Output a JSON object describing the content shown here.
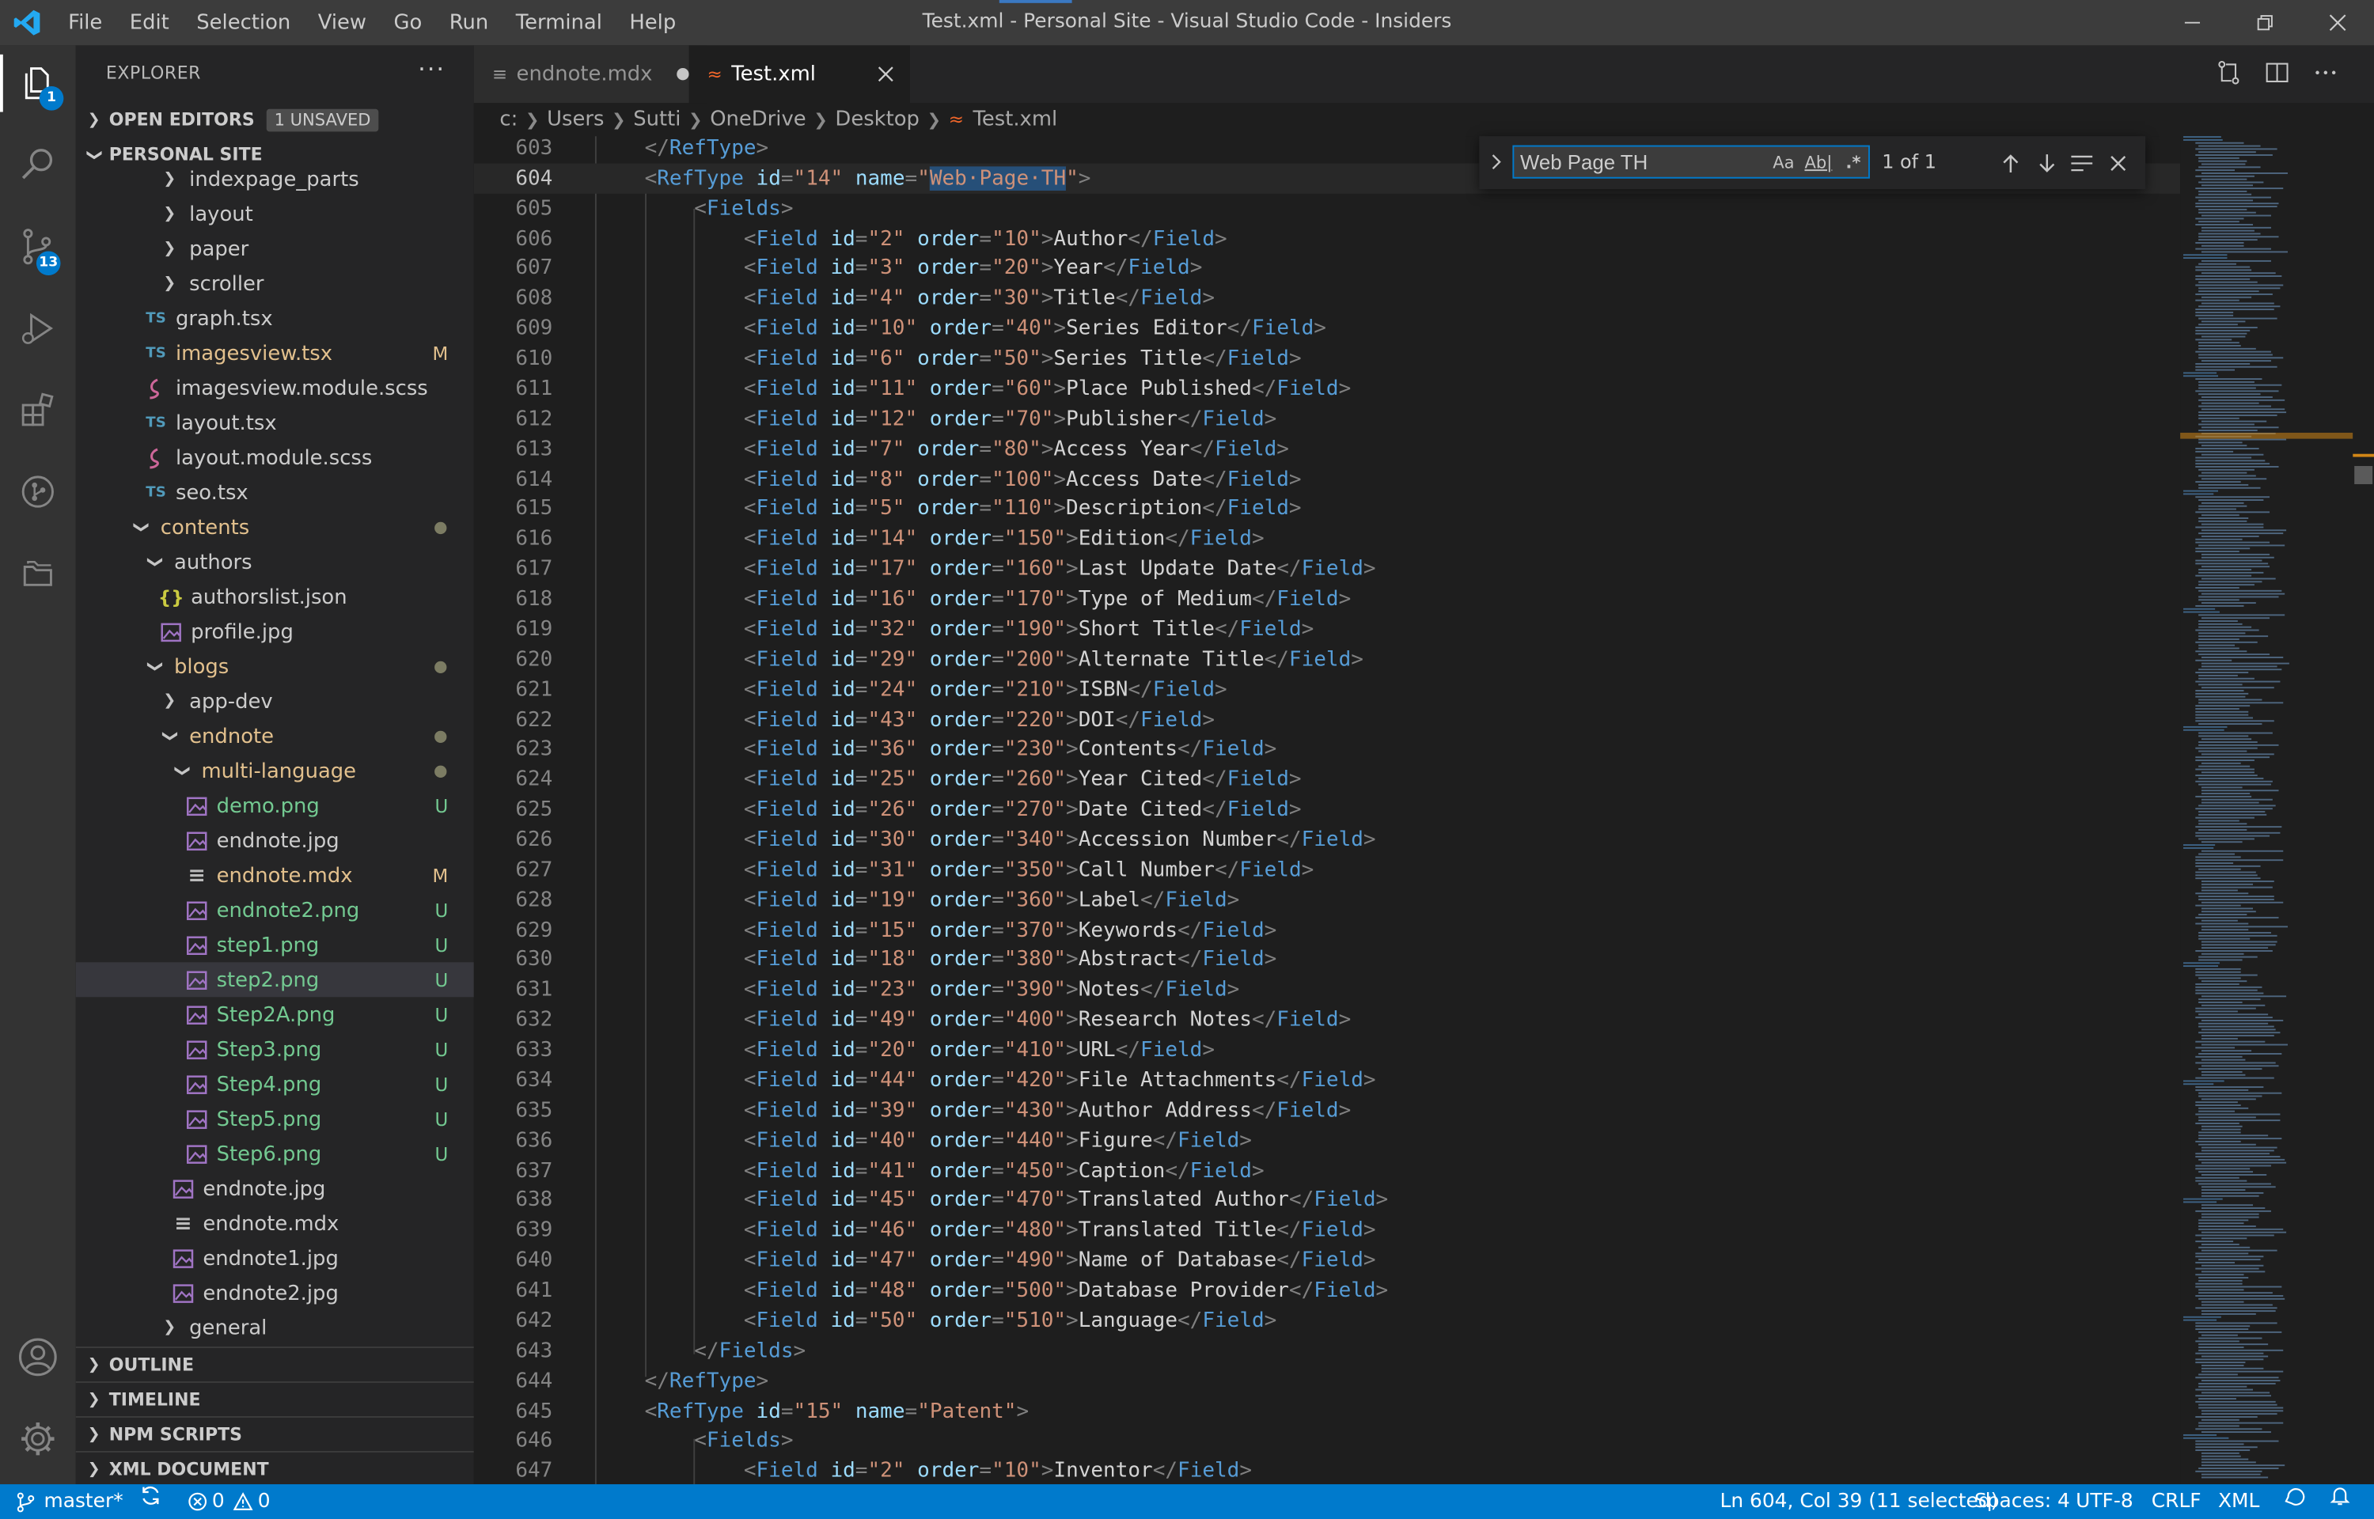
{
  "window": {
    "title": "Test.xml - Personal Site - Visual Studio Code - Insiders",
    "menu": [
      "File",
      "Edit",
      "Selection",
      "View",
      "Go",
      "Run",
      "Terminal",
      "Help"
    ]
  },
  "activity_bar": {
    "explorer_badge": "1",
    "source_control_badge": "13"
  },
  "sidebar": {
    "title": "EXPLORER",
    "more_label": "···",
    "open_editors": {
      "label": "OPEN EDITORS",
      "badge": "1 UNSAVED"
    },
    "workspace": "PERSONAL SITE",
    "tree": [
      {
        "label": "indexpage_parts",
        "kind": "folder",
        "expanded": false,
        "depth": 2
      },
      {
        "label": "layout",
        "kind": "folder",
        "expanded": false,
        "depth": 2
      },
      {
        "label": "paper",
        "kind": "folder",
        "expanded": false,
        "depth": 2
      },
      {
        "label": "scroller",
        "kind": "folder",
        "expanded": false,
        "depth": 2
      },
      {
        "label": "graph.tsx",
        "kind": "ts",
        "depth": 1
      },
      {
        "label": "imagesview.tsx",
        "kind": "ts",
        "depth": 1,
        "status": "M"
      },
      {
        "label": "imagesview.module.scss",
        "kind": "scss",
        "depth": 1
      },
      {
        "label": "layout.tsx",
        "kind": "ts",
        "depth": 1
      },
      {
        "label": "layout.module.scss",
        "kind": "scss",
        "depth": 1
      },
      {
        "label": "seo.tsx",
        "kind": "ts",
        "depth": 1
      },
      {
        "label": "contents",
        "kind": "folder",
        "expanded": true,
        "depth": 0,
        "dot": true
      },
      {
        "label": "authors",
        "kind": "folder",
        "expanded": true,
        "depth": 1
      },
      {
        "label": "authorslist.json",
        "kind": "json",
        "depth": 2
      },
      {
        "label": "profile.jpg",
        "kind": "img",
        "depth": 2
      },
      {
        "label": "blogs",
        "kind": "folder",
        "expanded": true,
        "depth": 1,
        "dot": true
      },
      {
        "label": "app-dev",
        "kind": "folder",
        "expanded": false,
        "depth": 2
      },
      {
        "label": "endnote",
        "kind": "folder",
        "expanded": true,
        "depth": 2,
        "dot": true
      },
      {
        "label": "multi-language",
        "kind": "folder",
        "expanded": true,
        "depth": 3,
        "dot": true
      },
      {
        "label": "demo.png",
        "kind": "img",
        "depth": 4,
        "status": "U"
      },
      {
        "label": "endnote.jpg",
        "kind": "img",
        "depth": 4
      },
      {
        "label": "endnote.mdx",
        "kind": "mdx",
        "depth": 4,
        "status": "M"
      },
      {
        "label": "endnote2.png",
        "kind": "img",
        "depth": 4,
        "status": "U"
      },
      {
        "label": "step1.png",
        "kind": "img",
        "depth": 4,
        "status": "U"
      },
      {
        "label": "step2.png",
        "kind": "img",
        "depth": 4,
        "status": "U",
        "selected": true
      },
      {
        "label": "Step2A.png",
        "kind": "img",
        "depth": 4,
        "status": "U"
      },
      {
        "label": "Step3.png",
        "kind": "img",
        "depth": 4,
        "status": "U"
      },
      {
        "label": "Step4.png",
        "kind": "img",
        "depth": 4,
        "status": "U"
      },
      {
        "label": "Step5.png",
        "kind": "img",
        "depth": 4,
        "status": "U"
      },
      {
        "label": "Step6.png",
        "kind": "img",
        "depth": 4,
        "status": "U"
      },
      {
        "label": "endnote.jpg",
        "kind": "img",
        "depth": 3
      },
      {
        "label": "endnote.mdx",
        "kind": "mdx",
        "depth": 3
      },
      {
        "label": "endnote1.jpg",
        "kind": "img",
        "depth": 3
      },
      {
        "label": "endnote2.jpg",
        "kind": "img",
        "depth": 3
      },
      {
        "label": "general",
        "kind": "folder",
        "expanded": false,
        "depth": 2
      }
    ],
    "bottom_sections": [
      "OUTLINE",
      "TIMELINE",
      "NPM SCRIPTS",
      "XML DOCUMENT"
    ]
  },
  "tabs": [
    {
      "label": "endnote.mdx",
      "active": false,
      "dirty": true
    },
    {
      "label": "Test.xml",
      "active": true,
      "dirty": false
    }
  ],
  "breadcrumb": [
    "c:",
    "Users",
    "Sutti",
    "OneDrive",
    "Desktop",
    "Test.xml"
  ],
  "find": {
    "value": "Web Page TH",
    "count": "1 of 1",
    "opt_case": "Aa",
    "opt_word": "Ab|",
    "opt_regex": ".*"
  },
  "editor": {
    "current_line": 604,
    "fields": [
      [
        "2",
        "10",
        "Author"
      ],
      [
        "3",
        "20",
        "Year"
      ],
      [
        "4",
        "30",
        "Title"
      ],
      [
        "10",
        "40",
        "Series Editor"
      ],
      [
        "6",
        "50",
        "Series Title"
      ],
      [
        "11",
        "60",
        "Place Published"
      ],
      [
        "12",
        "70",
        "Publisher"
      ],
      [
        "7",
        "80",
        "Access Year"
      ],
      [
        "8",
        "100",
        "Access Date"
      ],
      [
        "5",
        "110",
        "Description"
      ],
      [
        "14",
        "150",
        "Edition"
      ],
      [
        "17",
        "160",
        "Last Update Date"
      ],
      [
        "16",
        "170",
        "Type of Medium"
      ],
      [
        "32",
        "190",
        "Short Title"
      ],
      [
        "29",
        "200",
        "Alternate Title"
      ],
      [
        "24",
        "210",
        "ISBN"
      ],
      [
        "43",
        "220",
        "DOI"
      ],
      [
        "36",
        "230",
        "Contents"
      ],
      [
        "25",
        "260",
        "Year Cited"
      ],
      [
        "26",
        "270",
        "Date Cited"
      ],
      [
        "30",
        "340",
        "Accession Number"
      ],
      [
        "31",
        "350",
        "Call Number"
      ],
      [
        "19",
        "360",
        "Label"
      ],
      [
        "15",
        "370",
        "Keywords"
      ],
      [
        "18",
        "380",
        "Abstract"
      ],
      [
        "23",
        "390",
        "Notes"
      ],
      [
        "49",
        "400",
        "Research Notes"
      ],
      [
        "20",
        "410",
        "URL"
      ],
      [
        "44",
        "420",
        "File Attachments"
      ],
      [
        "39",
        "430",
        "Author Address"
      ],
      [
        "40",
        "440",
        "Figure"
      ],
      [
        "41",
        "450",
        "Caption"
      ],
      [
        "45",
        "470",
        "Translated Author"
      ],
      [
        "46",
        "480",
        "Translated Title"
      ],
      [
        "47",
        "490",
        "Name of Database"
      ],
      [
        "48",
        "500",
        "Database Provider"
      ],
      [
        "50",
        "510",
        "Language"
      ]
    ],
    "line_numbers": [
      "603",
      "604",
      "605",
      "606",
      "607",
      "608",
      "609",
      "610",
      "611",
      "612",
      "613",
      "614",
      "615",
      "616",
      "617",
      "618",
      "619",
      "620",
      "621",
      "622",
      "623",
      "624",
      "625",
      "626",
      "627",
      "628",
      "629",
      "630",
      "631",
      "632",
      "633",
      "634",
      "635",
      "636",
      "637",
      "638",
      "639",
      "640",
      "641",
      "642",
      "643",
      "644",
      "645",
      "646",
      "647"
    ],
    "reftype_a": {
      "id": "14",
      "name": "Web Page TH"
    },
    "reftype_b": {
      "id": "15",
      "name": "Patent"
    },
    "last_field": {
      "id": "2",
      "order": "10",
      "text": "Inventor"
    }
  },
  "status_bar": {
    "branch": "master*",
    "errors": "0",
    "warnings": "0",
    "position": "Ln 604, Col 39 (11 selected)",
    "spaces": "Spaces: 4",
    "encoding": "UTF-8",
    "eol": "CRLF",
    "language": "XML"
  },
  "colors": {
    "accent": "#007acc",
    "modified": "#e2c08d",
    "untracked": "#73c991"
  }
}
